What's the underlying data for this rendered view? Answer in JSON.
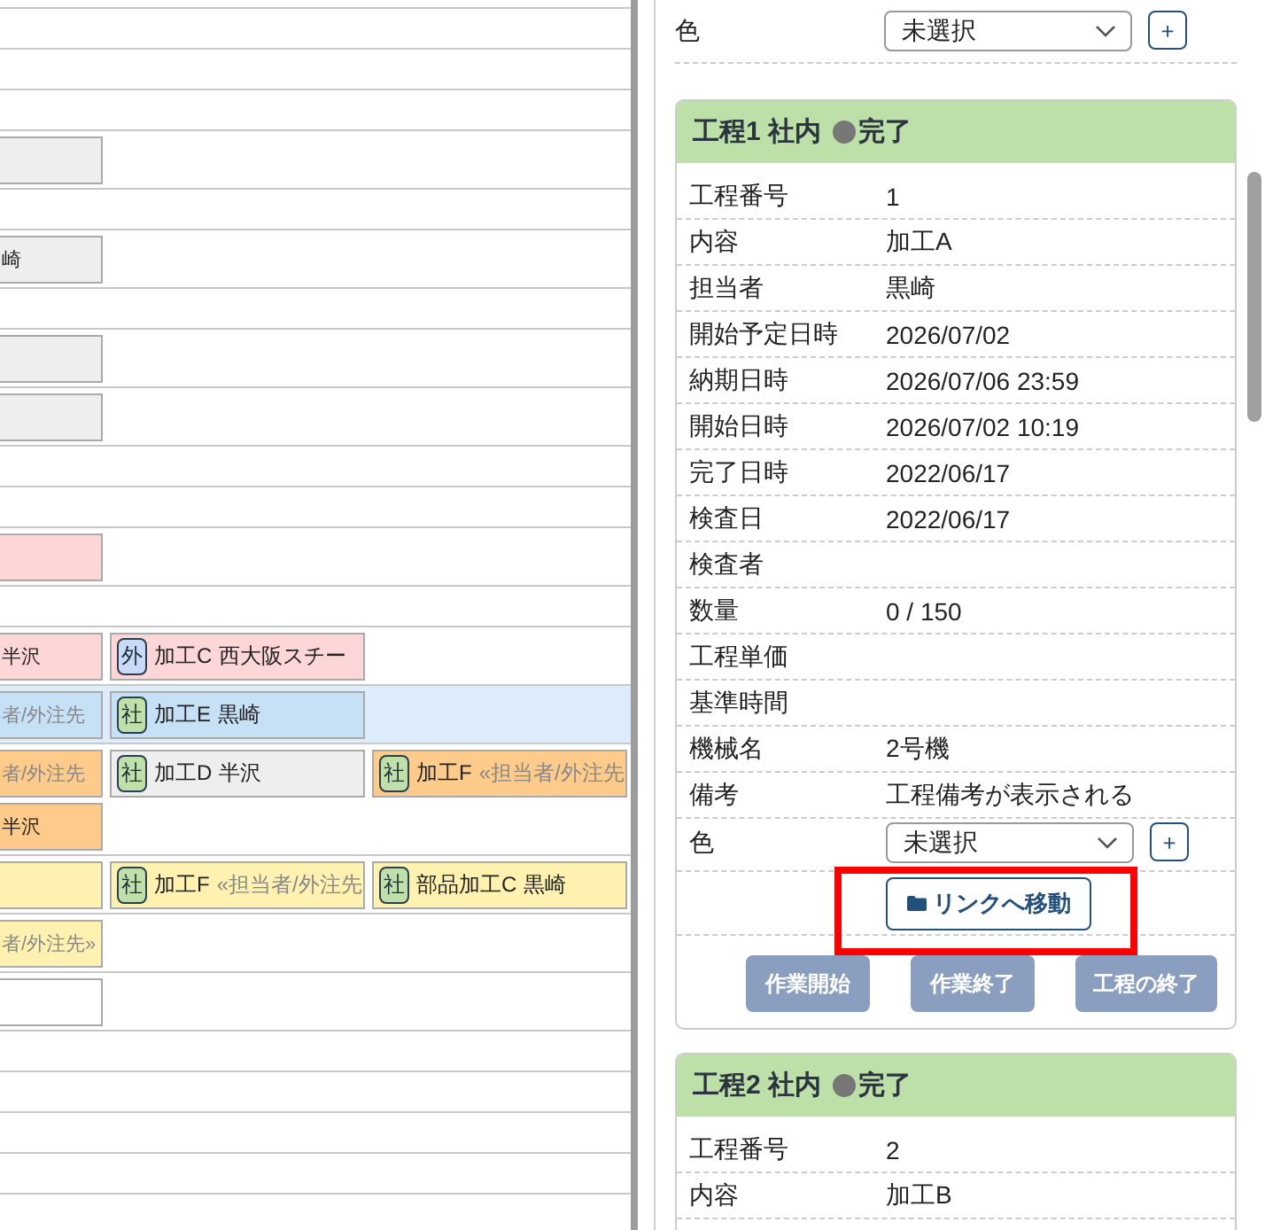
{
  "timeline": {
    "rows": [
      {
        "highlighted": false
      },
      {
        "highlighted": false
      },
      {
        "highlighted": false
      },
      {
        "highlighted": false
      },
      {
        "highlighted": false,
        "chips": [
          {
            "color": "#eeeeee"
          }
        ]
      },
      {
        "highlighted": false
      },
      {
        "highlighted": false,
        "chips": [
          {
            "color": "#eeeeee",
            "note": "崎",
            "note_muted": false
          }
        ]
      },
      {
        "highlighted": false
      },
      {
        "highlighted": false,
        "chips": [
          {
            "color": "#eeeeee"
          }
        ]
      },
      {
        "highlighted": false,
        "chips": [
          {
            "color": "#eeeeee"
          }
        ]
      },
      {
        "highlighted": false
      },
      {
        "highlighted": false
      },
      {
        "highlighted": false,
        "chips": [
          {
            "color": "#fdd7d7"
          }
        ]
      },
      {
        "highlighted": false
      },
      {
        "highlighted": false,
        "chips": [
          {
            "color": "#fdd7d7",
            "note": "半沢",
            "note_muted": false
          },
          {
            "color": "#fdd7d7",
            "badge": {
              "text": "外",
              "color": "#c9daf8"
            },
            "label": "加工C",
            "note": "西大阪スチー",
            "note_muted": false
          }
        ]
      },
      {
        "highlighted": true,
        "chips": [
          {
            "color": "#c6e0f5",
            "note": "者/外注先",
            "note_muted": true
          },
          {
            "color": "#c6e0f5",
            "badge": {
              "text": "社",
              "color": "#bfe1a9"
            },
            "label": "加工E",
            "note": "黒崎",
            "note_muted": false
          }
        ]
      },
      {
        "highlighted": false,
        "chips": [
          {
            "color": "#fecb8a",
            "note": "者/外注先",
            "note_muted": true
          },
          {
            "color": "#eeeeee",
            "badge": {
              "text": "社",
              "color": "#bfe1a9"
            },
            "label": "加工D",
            "note": "半沢",
            "note_muted": false
          },
          {
            "color": "#fecb8a",
            "badge": {
              "text": "社",
              "color": "#bfe1a9"
            },
            "label": "加工F",
            "note": "«担当者/外注先",
            "note_muted": true
          },
          {
            "color": "#fecb8a",
            "note": "半沢",
            "note_muted": false
          }
        ]
      },
      {
        "highlighted": false,
        "chips": [
          {
            "color": "#fff1b0"
          },
          {
            "color": "#fff1b0",
            "badge": {
              "text": "社",
              "color": "#bfe1a9"
            },
            "label": "加工F",
            "note": "«担当者/外注先",
            "note_muted": true
          },
          {
            "color": "#fff1b0",
            "badge": {
              "text": "社",
              "color": "#bfe1a9"
            },
            "label": "部品加工C",
            "note": "黒崎",
            "note_muted": false
          }
        ]
      },
      {
        "highlighted": false,
        "chips": [
          {
            "color": "#fff1b0",
            "note": "者/外注先»",
            "note_muted": true
          }
        ]
      },
      {
        "highlighted": false,
        "chips": [
          {
            "color": "#ffffff"
          }
        ]
      },
      {
        "highlighted": false
      },
      {
        "highlighted": false
      },
      {
        "highlighted": false
      },
      {
        "highlighted": false
      }
    ]
  },
  "panel": {
    "color_field": {
      "label": "色",
      "value": "未選択",
      "add": "+"
    },
    "processes": [
      {
        "title": "工程1 社内",
        "status": "完了",
        "fields": [
          {
            "label": "工程番号",
            "value": "1"
          },
          {
            "label": "内容",
            "value": "加工A"
          },
          {
            "label": "担当者",
            "value": "黒崎"
          },
          {
            "label": "開始予定日時",
            "value": "2026/07/02"
          },
          {
            "label": "納期日時",
            "value": "2026/07/06 23:59"
          },
          {
            "label": "開始日時",
            "value": "2026/07/02 10:19"
          },
          {
            "label": "完了日時",
            "value": "2022/06/17"
          },
          {
            "label": "検査日",
            "value": "2022/06/17"
          },
          {
            "label": "検査者"
          },
          {
            "label": "数量",
            "value": "0 / 150"
          },
          {
            "label": "工程単価"
          },
          {
            "label": "基準時間"
          },
          {
            "label": "機械名",
            "value": "2号機"
          },
          {
            "label": "備考",
            "value": "工程備考が表示される"
          }
        ],
        "color_field": {
          "label": "色",
          "value": "未選択",
          "add": "+"
        },
        "link_button": {
          "label": "リンクへ移動",
          "highlighted": true
        },
        "actions": [
          {
            "label": "作業開始",
            "disabled": true
          },
          {
            "label": "作業終了",
            "disabled": true
          },
          {
            "label": "工程の終了",
            "disabled": true
          }
        ]
      },
      {
        "title": "工程2 社内",
        "status": "完了",
        "fields": [
          {
            "label": "工程番号",
            "value": "2"
          },
          {
            "label": "内容",
            "value": "加工B"
          }
        ]
      }
    ]
  }
}
